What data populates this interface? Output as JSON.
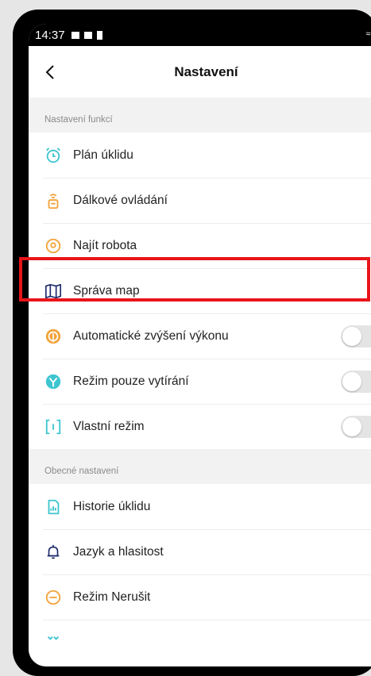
{
  "status_bar": {
    "time": "14:37"
  },
  "header": {
    "title": "Nastavení"
  },
  "sections": {
    "functions": {
      "title": "Nastavení funkcí",
      "items": [
        {
          "label": "Plán úklidu",
          "icon": "alarm-clock-icon",
          "control": "chevron"
        },
        {
          "label": "Dálkové ovládání",
          "icon": "remote-control-icon",
          "control": "chevron"
        },
        {
          "label": "Najít robota",
          "icon": "location-pin-icon",
          "control": "chevron"
        },
        {
          "label": "Správa map",
          "icon": "map-icon",
          "control": "chevron"
        },
        {
          "label": "Automatické zvýšení výkonu",
          "icon": "power-boost-icon",
          "control": "toggle",
          "on": false
        },
        {
          "label": "Režim pouze vytírání",
          "icon": "mop-icon",
          "control": "toggle",
          "on": false
        },
        {
          "label": "Vlastní režim",
          "icon": "custom-mode-icon",
          "control": "toggle",
          "on": false
        }
      ]
    },
    "general": {
      "title": "Obecné nastavení",
      "items": [
        {
          "label": "Historie úklidu",
          "icon": "history-chart-icon",
          "control": "chevron"
        },
        {
          "label": "Jazyk a hlasitost",
          "icon": "bell-icon",
          "control": "chevron"
        },
        {
          "label": "Režim Nerušit",
          "icon": "do-not-disturb-icon",
          "control": "chevron"
        }
      ]
    }
  },
  "chevron_glyph": ">",
  "colors": {
    "teal": "#3ec5d0",
    "orange": "#f2a33a",
    "navy": "#1c2a6b",
    "highlight": "#e8141a"
  }
}
